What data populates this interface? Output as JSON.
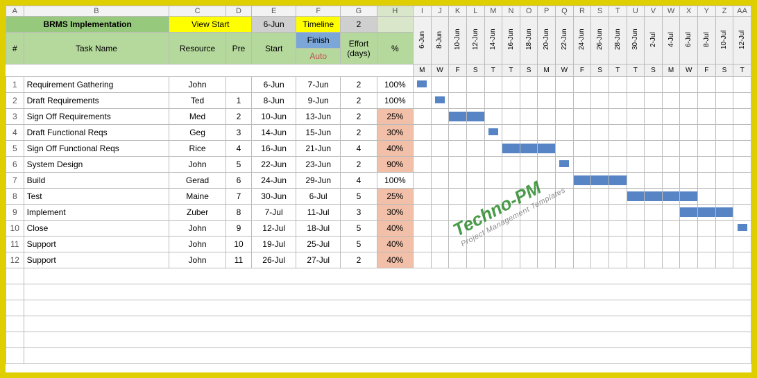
{
  "cols": [
    "A",
    "B",
    "C",
    "D",
    "E",
    "F",
    "G",
    "H",
    "I",
    "J",
    "K",
    "L",
    "M",
    "N",
    "O",
    "P",
    "Q",
    "R",
    "S",
    "T",
    "U",
    "V",
    "W",
    "X",
    "Y",
    "Z",
    "AA"
  ],
  "row1": {
    "title": "BRMS Implementation",
    "viewstart": "View Start",
    "date": "6-Jun",
    "timeline": "Timeline",
    "tval": "2"
  },
  "row2": {
    "num": "#",
    "task": "Task Name",
    "resource": "Resource",
    "pre": "Pre",
    "start": "Start",
    "finish": "Finish",
    "effort": "Effort (days)",
    "pct": "%"
  },
  "row3": {
    "auto": "Auto"
  },
  "dates": [
    "6-Jun",
    "8-Jun",
    "10-Jun",
    "12-Jun",
    "14-Jun",
    "16-Jun",
    "18-Jun",
    "20-Jun",
    "22-Jun",
    "24-Jun",
    "26-Jun",
    "28-Jun",
    "30-Jun",
    "2-Jul",
    "4-Jul",
    "6-Jul",
    "8-Jul",
    "10-Jul",
    "12-Jul"
  ],
  "dow": [
    "M",
    "W",
    "F",
    "S",
    "T",
    "T",
    "S",
    "M",
    "W",
    "F",
    "S",
    "T",
    "T",
    "S",
    "M",
    "W",
    "F",
    "S",
    "T"
  ],
  "tasks": [
    {
      "n": "1",
      "name": "Requirement Gathering",
      "res": "John",
      "pre": "",
      "start": "6-Jun",
      "finish": "7-Jun",
      "eff": "2",
      "pct": "100%",
      "low": false,
      "bar": [
        0,
        0
      ]
    },
    {
      "n": "2",
      "name": "Draft  Requirements",
      "res": "Ted",
      "pre": "1",
      "start": "8-Jun",
      "finish": "9-Jun",
      "eff": "2",
      "pct": "100%",
      "low": false,
      "bar": [
        1,
        1
      ]
    },
    {
      "n": "3",
      "name": "Sign Off  Requirements",
      "res": "Med",
      "pre": "2",
      "start": "10-Jun",
      "finish": "13-Jun",
      "eff": "2",
      "pct": "25%",
      "low": true,
      "bar": [
        2,
        3
      ]
    },
    {
      "n": "4",
      "name": "Draft Functional Reqs",
      "res": "Geg",
      "pre": "3",
      "start": "14-Jun",
      "finish": "15-Jun",
      "eff": "2",
      "pct": "30%",
      "low": true,
      "bar": [
        4,
        4
      ]
    },
    {
      "n": "5",
      "name": "Sign Off Functional Reqs",
      "res": "Rice",
      "pre": "4",
      "start": "16-Jun",
      "finish": "21-Jun",
      "eff": "4",
      "pct": "40%",
      "low": true,
      "bar": [
        5,
        7
      ]
    },
    {
      "n": "6",
      "name": "System Design",
      "res": "John",
      "pre": "5",
      "start": "22-Jun",
      "finish": "23-Jun",
      "eff": "2",
      "pct": "90%",
      "low": true,
      "bar": [
        8,
        8
      ]
    },
    {
      "n": "7",
      "name": "Build",
      "res": "Gerad",
      "pre": "6",
      "start": "24-Jun",
      "finish": "29-Jun",
      "eff": "4",
      "pct": "100%",
      "low": false,
      "bar": [
        9,
        11
      ]
    },
    {
      "n": "8",
      "name": "Test",
      "res": "Maine",
      "pre": "7",
      "start": "30-Jun",
      "finish": "6-Jul",
      "eff": "5",
      "pct": "25%",
      "low": true,
      "bar": [
        12,
        15
      ]
    },
    {
      "n": "9",
      "name": "Implement",
      "res": "Zuber",
      "pre": "8",
      "start": "7-Jul",
      "finish": "11-Jul",
      "eff": "3",
      "pct": "30%",
      "low": true,
      "bar": [
        15,
        17
      ]
    },
    {
      "n": "10",
      "name": "Close",
      "res": "John",
      "pre": "9",
      "start": "12-Jul",
      "finish": "18-Jul",
      "eff": "5",
      "pct": "40%",
      "low": true,
      "bar": [
        18,
        18
      ]
    },
    {
      "n": "11",
      "name": "Support",
      "res": "John",
      "pre": "10",
      "start": "19-Jul",
      "finish": "25-Jul",
      "eff": "5",
      "pct": "40%",
      "low": true,
      "bar": null
    },
    {
      "n": "12",
      "name": "Support",
      "res": "John",
      "pre": "11",
      "start": "26-Jul",
      "finish": "27-Jul",
      "eff": "2",
      "pct": "40%",
      "low": true,
      "bar": null
    }
  ],
  "watermark": {
    "t1": "Techno-PM",
    "t2": "Project Management Templates"
  }
}
